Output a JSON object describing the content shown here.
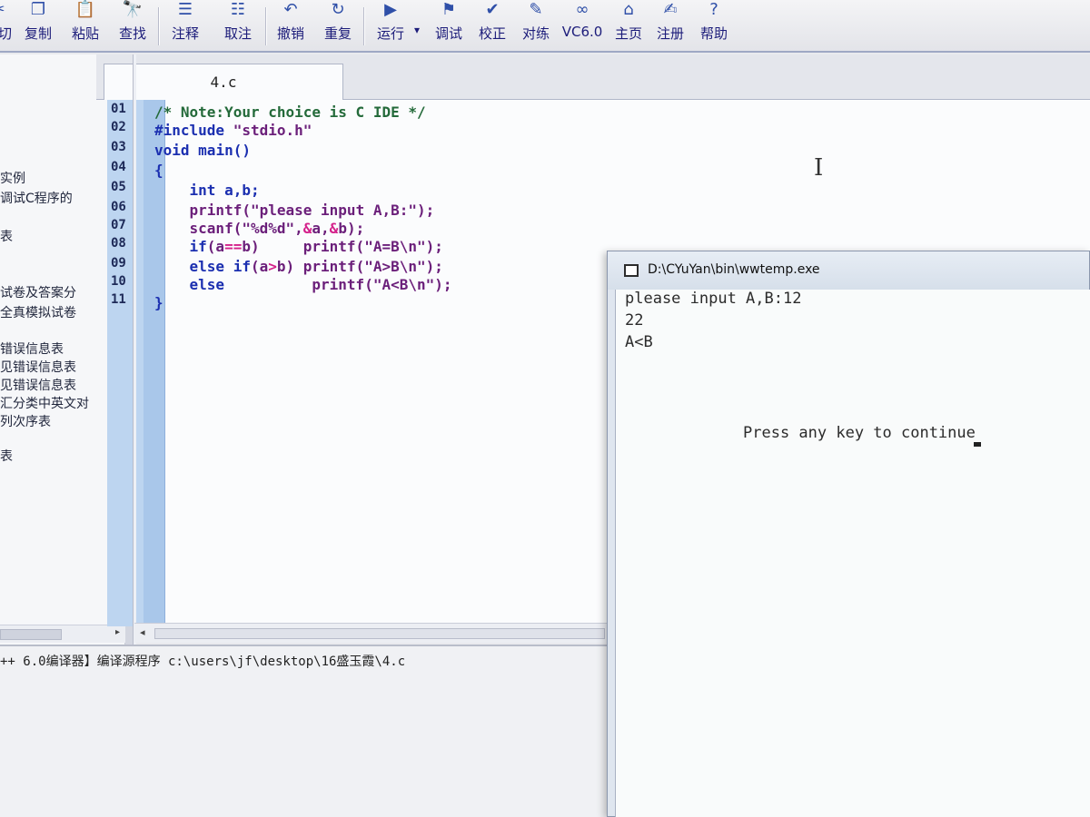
{
  "toolbar": {
    "buttons": [
      {
        "label": "剪切",
        "icon": "cut-icon",
        "glyph": "✂"
      },
      {
        "label": "复制",
        "icon": "copy-icon",
        "glyph": "❐"
      },
      {
        "label": "粘贴",
        "icon": "paste-icon",
        "glyph": "📋"
      },
      {
        "label": "查找",
        "icon": "find-icon",
        "glyph": "🔭"
      },
      {
        "label": "注释",
        "icon": "comment-icon",
        "glyph": "☰"
      },
      {
        "label": "取注",
        "icon": "uncomment-icon",
        "glyph": "☷"
      },
      {
        "label": "撤销",
        "icon": "undo-icon",
        "glyph": "↶"
      },
      {
        "label": "重复",
        "icon": "redo-icon",
        "glyph": "↻"
      },
      {
        "label": "运行",
        "icon": "run-icon",
        "glyph": "▶"
      },
      {
        "label": "调试",
        "icon": "debug-icon",
        "glyph": "⚑"
      },
      {
        "label": "校正",
        "icon": "check-icon",
        "glyph": "✔"
      },
      {
        "label": "对练",
        "icon": "practice-icon",
        "glyph": "✎"
      },
      {
        "label": "VC6.0",
        "icon": "vc6-icon",
        "glyph": "∞"
      },
      {
        "label": "主页",
        "icon": "home-icon",
        "glyph": "⌂"
      },
      {
        "label": "注册",
        "icon": "register-icon",
        "glyph": "✍"
      },
      {
        "label": "帮助",
        "icon": "help-icon",
        "glyph": "?"
      }
    ],
    "run_dropdown": "▾"
  },
  "left_panel": {
    "items": [
      "实例",
      "调试C程序的",
      "表",
      "试卷及答案分",
      "全真模拟试卷",
      "错误信息表",
      "见错误信息表",
      "见错误信息表",
      "汇分类中英文对",
      "列次序表",
      "表"
    ]
  },
  "editor": {
    "tab_label": "4.c",
    "line_numbers": [
      "01",
      "02",
      "03",
      "04",
      "05",
      "06",
      "07",
      "08",
      "09",
      "10",
      "11"
    ]
  },
  "output": {
    "line": "++ 6.0编译器】编译源程序 c:\\users\\jf\\desktop\\16盛玉霞\\4.c"
  },
  "console": {
    "title": "D:\\CYuYan\\bin\\wwtemp.exe",
    "lines": [
      "please input A,B:12",
      "22",
      "A<B"
    ],
    "continue_msg": "Press any key to continue"
  },
  "colors": {
    "gutter": "#a9c7ea",
    "keyword": "#1b2fb0",
    "comment": "#246a3a",
    "string": "#7a1f88",
    "operator": "#d4208a"
  }
}
